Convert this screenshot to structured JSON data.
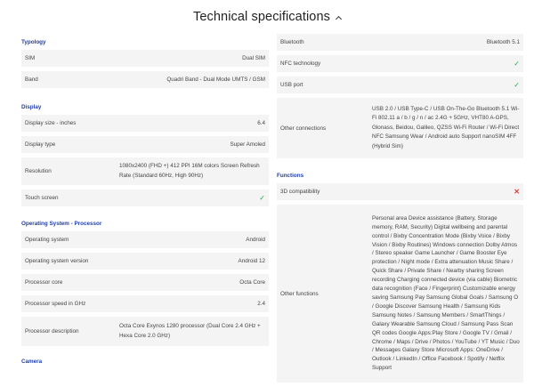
{
  "header": {
    "title": "Technical specifications"
  },
  "left": {
    "sections": [
      {
        "title": "Typology",
        "rows": [
          {
            "label": "SIM",
            "value": "Dual SIM"
          },
          {
            "label": "Band",
            "value": "Quadri Band - Dual Mode UMTS / GSM"
          }
        ]
      },
      {
        "title": "Display",
        "rows": [
          {
            "label": "Display size - inches",
            "value": "6.4"
          },
          {
            "label": "Display type",
            "value": "Super Amoled"
          },
          {
            "label": "Resolution",
            "value": "1080x2400 (FHD +) 412 PPI 16M colors Screen Refresh Rate (Standard 60Hz, High 90Hz)"
          },
          {
            "label": "Touch screen",
            "value": "✓"
          }
        ]
      },
      {
        "title": "Operating System - Processor",
        "rows": [
          {
            "label": "Operating system",
            "value": "Android"
          },
          {
            "label": "Operating system version",
            "value": "Android 12"
          },
          {
            "label": "Processor core",
            "value": "Octa Core"
          },
          {
            "label": "Processor speed in GHz",
            "value": "2.4"
          },
          {
            "label": "Processor description",
            "value": "Octa Core Exynos 1280 processor (Dual Core 2.4 GHz + Hexa Core 2.0 GHz)"
          }
        ]
      },
      {
        "title": "Camera"
      }
    ]
  },
  "right": {
    "rows_top": [
      {
        "label": "Bluetooth",
        "value": "Bluetooth 5.1"
      },
      {
        "label": "NFC technology",
        "value": "✓"
      },
      {
        "label": "USB port",
        "value": "✓"
      },
      {
        "label": "Other connections",
        "value": "USB 2.0 / USB Type-C / USB On-The-Go Bluetooth 5.1 Wi-Fi 802.11 a / b / g / n / ac 2.4G + 5GHz, VHT80 A-GPS, Glonass, Beidou, Galileo, QZSS Wi-Fi Router / Wi-Fi Direct NFC Samsung Wear / Android auto Support nanoSIM 4FF (Hybrid Sim)"
      }
    ],
    "functions_title": "Functions",
    "rows_functions": [
      {
        "label": "3D compatibility",
        "value": "✕"
      },
      {
        "label": "Other functions",
        "value": "Personal area Device assistance (Battery, Storage memory, RAM, Security) Digital wellbeing and parental control / Bixby Concentration Mode (Bixby Voice / Bixby Vision / Bixby Routines) Windows connection Dolby Atmos / Stereo speaker Game Launcher / Game Booster Eye protection / Night mode / Extra attenuation Music Share / Quick Share / Private Share / Nearby sharing Screen recording Charging connected device (via cable) Biometric data recognition (Face / Fingerprint) Customizable energy saving Samsung Pay Samsung Global Goals / Samsung O / Google Discover Samsung Health / Samsung Kids Samsung Notes / Samsung Members / SmartThings / Galaxy Wearable Samsung Cloud / Samsung Pass Scan QR codes Google Apps:Play Store / Google TV / Gmail / Chrome / Maps / Drive / Photos / YouTube / YT Music / Duo / Messages Galaxy Store Microsoft Apps: OneDrive / Outlook / LinkedIn / Office Facebook / Spotify / Netflix Support"
      }
    ]
  },
  "colors": {
    "accent": "#1f3ea8",
    "check": "#2aa64b",
    "cross": "#e23a3a",
    "row_bg": "#f4f4f4"
  }
}
